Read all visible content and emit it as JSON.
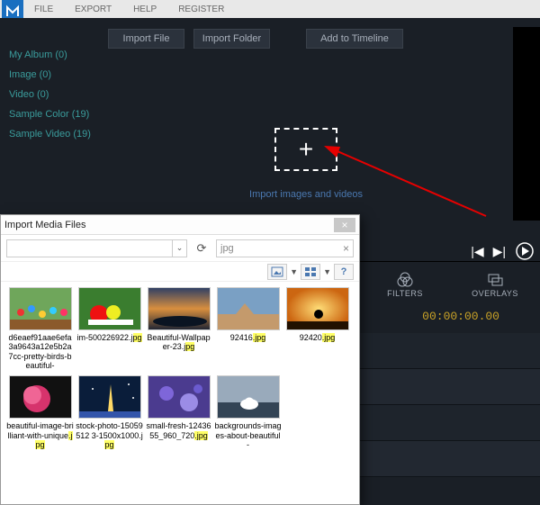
{
  "menu": {
    "items": [
      "FILE",
      "EXPORT",
      "HELP",
      "REGISTER"
    ]
  },
  "sidebar": {
    "items": [
      {
        "label": "My Album (0)"
      },
      {
        "label": "Image (0)"
      },
      {
        "label": "Video (0)"
      },
      {
        "label": "Sample Color (19)"
      },
      {
        "label": "Sample Video (19)"
      }
    ]
  },
  "import_buttons": {
    "file": "Import File",
    "folder": "Import Folder",
    "timeline": "Add to Timeline"
  },
  "dropzone": {
    "plus": "+",
    "label": "Import images and videos"
  },
  "transport_icons": {
    "prev": "prev-frame-icon",
    "next": "next-frame-icon",
    "play": "play-icon"
  },
  "bottom_tabs": {
    "filters": "FILTERS",
    "overlays": "OVERLAYS"
  },
  "timecode": "00:00:00.00",
  "dialog": {
    "title": "Import Media Files",
    "close": "×",
    "path_value": "",
    "dropdown_caret": "⌄",
    "refresh": "⟳",
    "search_value": "jpg",
    "search_clear": "×",
    "files": [
      {
        "name_pre": "d6eaef91aae6efa3a9643a12e5b2a7cc-pretty-birds-beautiful-",
        "ext": ""
      },
      {
        "name_pre": "im-500226922.j",
        "ext": "pg"
      },
      {
        "name_pre": "Beautiful-Wallpaper-23.j",
        "ext": "pg"
      },
      {
        "name_pre": "92416",
        "ext": ".jpg"
      },
      {
        "name_pre": "92420",
        "ext": ".jpg"
      },
      {
        "name_pre": "beautiful-image-brilliant-with-unique",
        "ext": ".jpg"
      },
      {
        "name_pre": "stock-photo-15059512 3-1500x1000.j",
        "ext": "pg"
      },
      {
        "name_pre": "small-fresh-1243655_960_720",
        "ext": ".jpg"
      },
      {
        "name_pre": "backgrounds-images-about-beautiful-",
        "ext": ""
      }
    ]
  }
}
